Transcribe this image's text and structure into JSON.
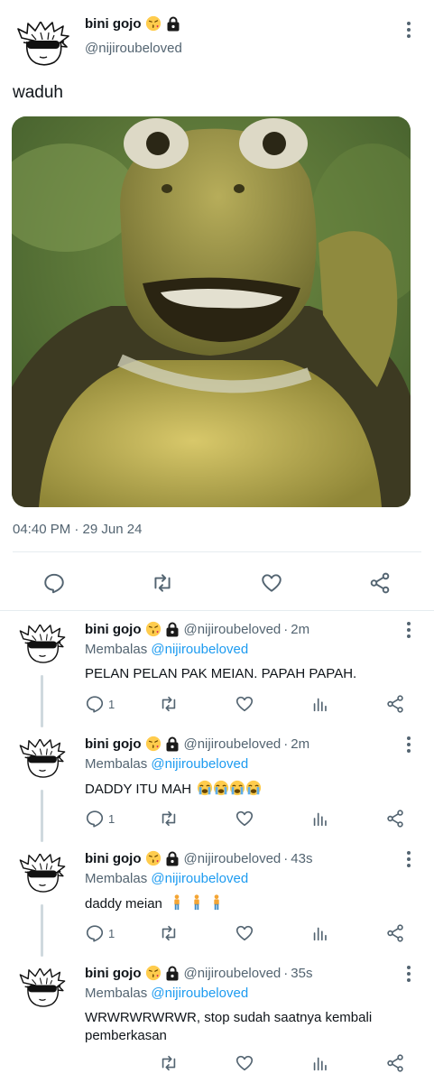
{
  "author": {
    "name": "bini gojo",
    "handle": "@nijiroubeloved",
    "badges": [
      "kissing-heart-emoji",
      "lock-emoji"
    ]
  },
  "tweet": {
    "text": "waduh",
    "media": "turtle-gif-still",
    "time": "04:40 PM · 29 Jun 24"
  },
  "actions": [
    "reply-icon",
    "retweet-icon",
    "like-icon",
    "share-icon"
  ],
  "reply_prefix": "Membalas",
  "replies": [
    {
      "name": "bini gojo",
      "handle": "@nijiroubeloved",
      "sep": "·",
      "time": "2m",
      "mention": "@nijiroubeloved",
      "text": "PELAN PELAN PAK MEIAN. PAPAH PAPAH.",
      "emoji": "",
      "reply_count": "1"
    },
    {
      "name": "bini gojo",
      "handle": "@nijiroubeloved",
      "sep": "·",
      "time": "2m",
      "mention": "@nijiroubeloved",
      "text": "DADDY ITU MAH",
      "emoji": "loudly-crying-face x4",
      "reply_count": "1"
    },
    {
      "name": "bini gojo",
      "handle": "@nijiroubeloved",
      "sep": "·",
      "time": "43s",
      "mention": "@nijiroubeloved",
      "text": "daddy meian",
      "emoji": "person-standing x3",
      "reply_count": "1"
    },
    {
      "name": "bini gojo",
      "handle": "@nijiroubeloved",
      "sep": "·",
      "time": "35s",
      "mention": "@nijiroubeloved",
      "text": "WRWRWRWRWR, stop sudah saatnya kembali pemberkasan",
      "emoji": "",
      "reply_count": ""
    }
  ],
  "colors": {
    "text": "#0f1419",
    "muted": "#536471",
    "link": "#1d9bf0",
    "divider": "#e6ecf0"
  }
}
